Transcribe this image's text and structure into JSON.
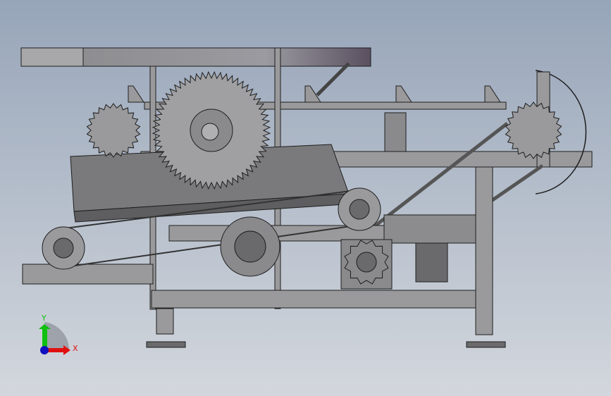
{
  "viewport": {
    "background_top": "#97a5b9",
    "background_bottom": "#d3d7dd"
  },
  "model": {
    "metal_color": "#9a9a9c",
    "metal_dark": "#5e5e60",
    "outline_color": "#1e1e1e"
  },
  "triad": {
    "x_label": "X",
    "y_label": "Y",
    "x_color": "#e01010",
    "y_color": "#10c010",
    "z_color": "#1010c0"
  }
}
